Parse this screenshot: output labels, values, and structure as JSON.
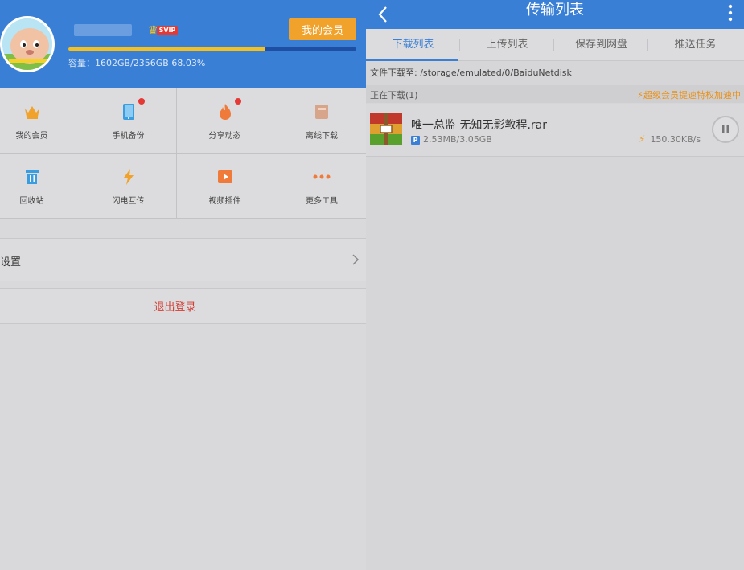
{
  "left_panel": {
    "profile": {
      "svip_badge": "SVIP",
      "my_vip_button": "我的会员",
      "capacity_text": "容量：1602GB/2356GB 68.03%",
      "capacity_percent": 68.03
    },
    "tools": [
      {
        "label": "我的会员",
        "icon": "crown-icon",
        "badge": false
      },
      {
        "label": "手机备份",
        "icon": "phone-icon",
        "badge": true
      },
      {
        "label": "分享动态",
        "icon": "flame-icon",
        "badge": true
      },
      {
        "label": "离线下载",
        "icon": "offline-download-icon",
        "badge": false
      },
      {
        "label": "回收站",
        "icon": "trash-icon",
        "badge": false
      },
      {
        "label": "闪电互传",
        "icon": "lightning-icon",
        "badge": false
      },
      {
        "label": "视频插件",
        "icon": "video-play-icon",
        "badge": false
      },
      {
        "label": "更多工具",
        "icon": "more-dots-icon",
        "badge": false
      }
    ],
    "settings_label": "设置",
    "logout_label": "退出登录"
  },
  "right_panel": {
    "title": "传输列表",
    "tabs": [
      {
        "label": "下载列表",
        "active": true
      },
      {
        "label": "上传列表",
        "active": false
      },
      {
        "label": "保存到网盘",
        "active": false
      },
      {
        "label": "推送任务",
        "active": false
      }
    ],
    "save_path": "文件下载至: /storage/emulated/0/BaiduNetdisk",
    "section_label": "正在下载(1)",
    "vip_speed_text": "⚡超级会员提速特权加速中",
    "file": {
      "name": "唯一总监  无知无影教程.rar",
      "source_badge": "P",
      "size_progress": "2.53MB/3.05GB",
      "speed": "150.30KB/s"
    }
  },
  "colors": {
    "header_blue": "#3a7fd6",
    "accent_orange": "#f0a22b",
    "logout_red": "#d23b32",
    "notify_dot": "#e53935"
  }
}
